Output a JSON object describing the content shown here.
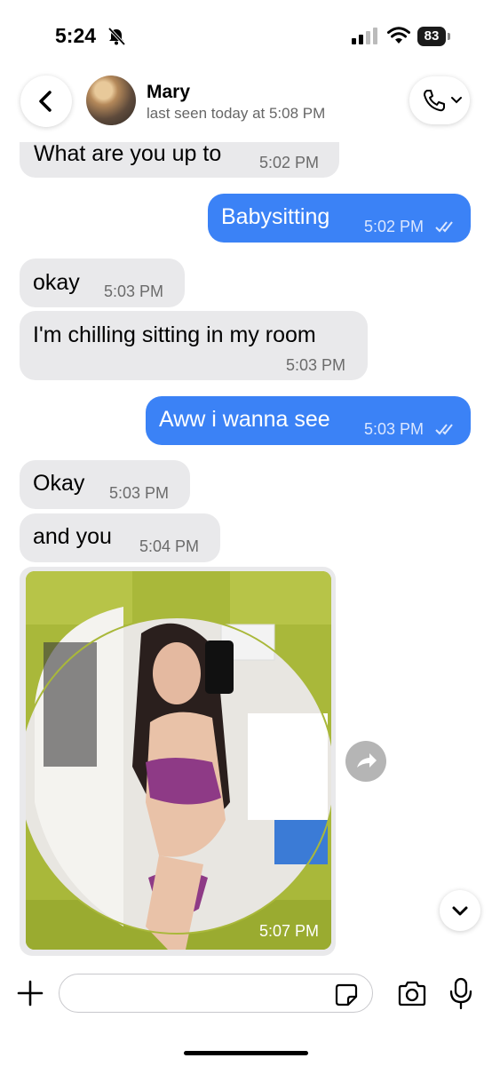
{
  "status_bar": {
    "time": "5:24",
    "battery": "83"
  },
  "header": {
    "contact_name": "Mary",
    "last_seen": "last seen today at 5:08 PM"
  },
  "messages": [
    {
      "direction": "in",
      "text": "What are you up to",
      "time": "5:02 PM"
    },
    {
      "direction": "out",
      "text": "Babysitting",
      "time": "5:02 PM",
      "read": true
    },
    {
      "direction": "in",
      "text": "okay",
      "time": "5:03 PM"
    },
    {
      "direction": "in",
      "text": "I'm chilling sitting in my room",
      "time": "5:03 PM"
    },
    {
      "direction": "out",
      "text": "Aww i wanna see",
      "time": "5:03 PM",
      "read": true
    },
    {
      "direction": "in",
      "text": "Okay",
      "time": "5:03 PM"
    },
    {
      "direction": "in",
      "text": "and you",
      "time": "5:04 PM"
    },
    {
      "direction": "in",
      "type": "photo",
      "time": "5:07 PM"
    }
  ],
  "composer": {
    "value": "",
    "placeholder": ""
  },
  "colors": {
    "outgoing_bubble": "#3b82f6",
    "incoming_bubble": "#e9e9eb"
  },
  "icons": [
    "back-icon",
    "phone-icon",
    "chevron-down-icon",
    "forward-icon",
    "plus-icon",
    "sticker-icon",
    "camera-icon",
    "mic-icon",
    "bell-slash-icon",
    "signal-icon",
    "wifi-icon"
  ]
}
